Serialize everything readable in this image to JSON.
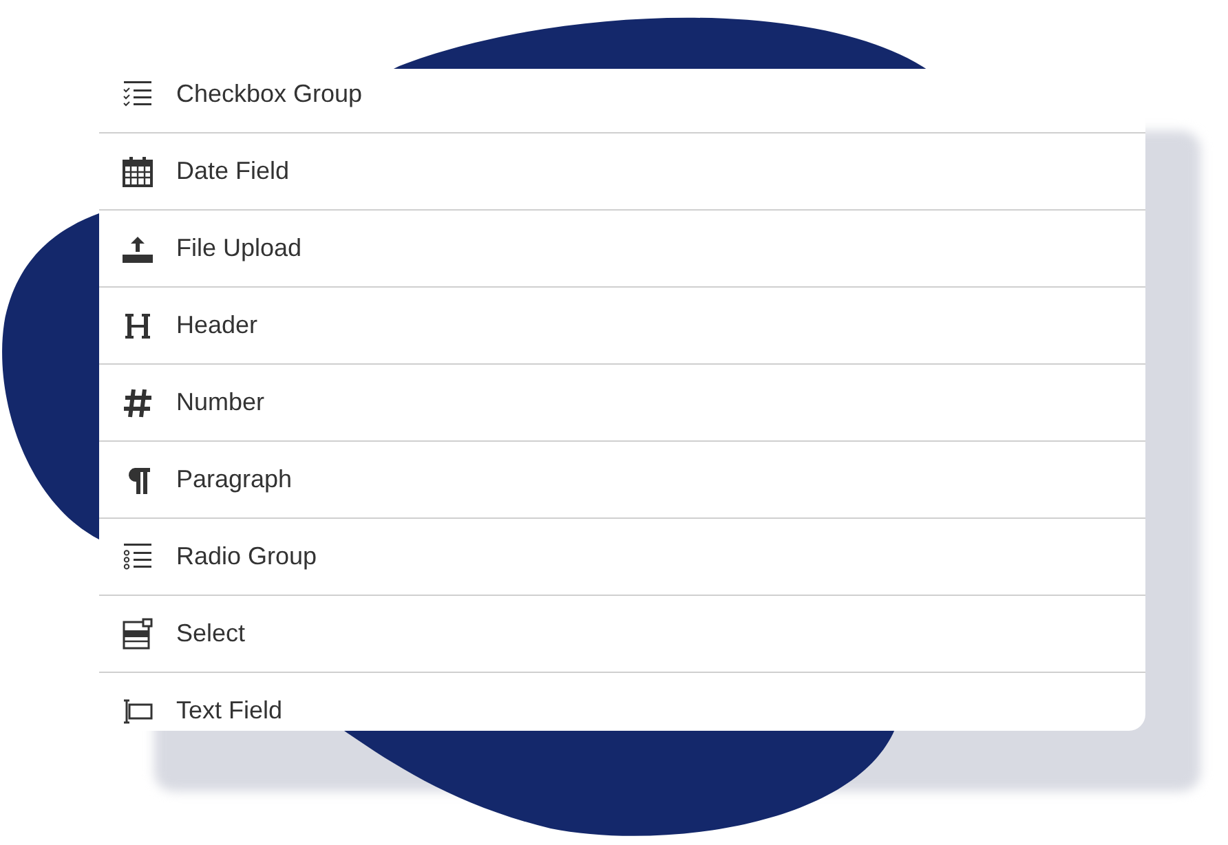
{
  "fields": [
    {
      "label": "Checkbox Group",
      "kind": "checkbox"
    },
    {
      "label": "Date Field",
      "kind": "date"
    },
    {
      "label": "File Upload",
      "kind": "upload"
    },
    {
      "label": "Header",
      "kind": "header"
    },
    {
      "label": "Number",
      "kind": "number"
    },
    {
      "label": "Paragraph",
      "kind": "paragraph"
    },
    {
      "label": "Radio Group",
      "kind": "radio"
    },
    {
      "label": "Select",
      "kind": "select"
    },
    {
      "label": "Text Field",
      "kind": "text"
    }
  ]
}
